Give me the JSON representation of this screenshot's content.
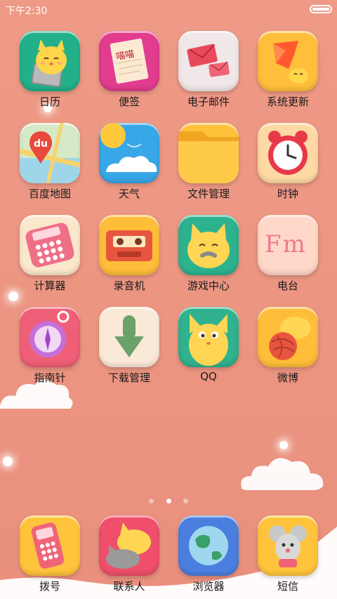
{
  "status_bar": {
    "time": "下午2:30"
  },
  "apps": [
    {
      "label": "日历"
    },
    {
      "label": "便签",
      "note_text": "喵喵"
    },
    {
      "label": "电子邮件"
    },
    {
      "label": "系统更新"
    },
    {
      "label": "百度地图",
      "logo_text": "du"
    },
    {
      "label": "天气"
    },
    {
      "label": "文件管理"
    },
    {
      "label": "时钟"
    },
    {
      "label": "计算器"
    },
    {
      "label": "录音机"
    },
    {
      "label": "游戏中心"
    },
    {
      "label": "电台",
      "logo_text": "Fm"
    },
    {
      "label": "指南针"
    },
    {
      "label": "下载管理"
    },
    {
      "label": "QQ"
    },
    {
      "label": "微博"
    }
  ],
  "dock": [
    {
      "label": "拨号"
    },
    {
      "label": "联系人"
    },
    {
      "label": "浏览器"
    },
    {
      "label": "短信"
    }
  ],
  "pager": {
    "pages": 3,
    "active": 2
  },
  "icon_names": {
    "apps": [
      "cat-calendar-icon",
      "note-paper-icon",
      "envelope-icon",
      "update-flag-icon",
      "map-pin-icon",
      "sun-cloud-icon",
      "folder-icon",
      "alarm-clock-icon",
      "calculator-icon",
      "cassette-icon",
      "cat-gamepad-icon",
      "fm-radio-icon",
      "compass-icon",
      "download-arrow-icon",
      "cat-qq-icon",
      "cat-yarn-icon"
    ],
    "dock": [
      "phone-icon",
      "cat-contacts-icon",
      "globe-icon",
      "mouse-message-icon"
    ]
  },
  "colors": {
    "background": "#ec9582",
    "label_text": "#1a1a1a",
    "status_text": "#ffffff"
  }
}
